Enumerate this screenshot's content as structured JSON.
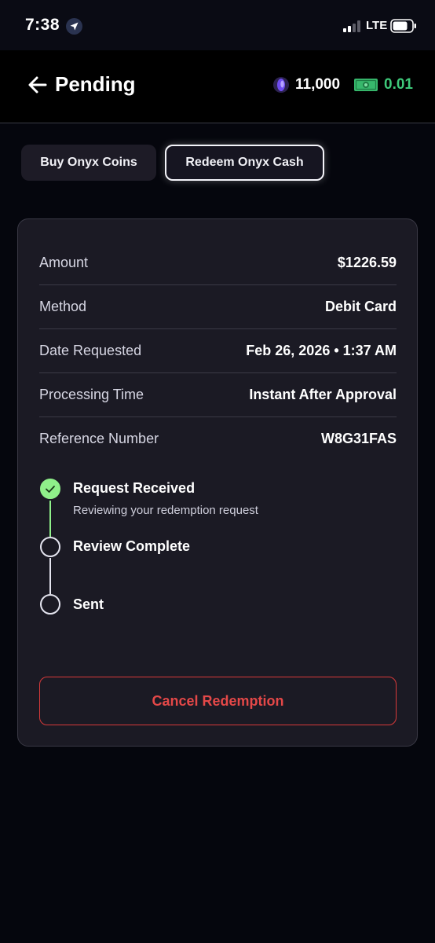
{
  "status_bar": {
    "time": "7:38",
    "network": "LTE"
  },
  "header": {
    "title": "Pending",
    "coin_balance": "11,000",
    "cash_balance": "0.01"
  },
  "tabs": [
    {
      "label": "Buy Onyx Coins",
      "active": false
    },
    {
      "label": "Redeem Onyx Cash",
      "active": true
    }
  ],
  "details": [
    {
      "label": "Amount",
      "value": "$1226.59"
    },
    {
      "label": "Method",
      "value": "Debit Card"
    },
    {
      "label": "Date Requested",
      "value": "Feb 26, 2026 • 1:37 AM"
    },
    {
      "label": "Processing Time",
      "value": "Instant After Approval"
    },
    {
      "label": "Reference Number",
      "value": "W8G31FAS"
    }
  ],
  "steps": [
    {
      "title": "Request Received",
      "subtitle": "Reviewing your redemption request",
      "done": true
    },
    {
      "title": "Review Complete",
      "done": false
    },
    {
      "title": "Sent",
      "done": false
    }
  ],
  "cancel_label": "Cancel Redemption",
  "colors": {
    "background": "#05060d",
    "card": "#1b1a24",
    "success": "#8ff08a",
    "cash_green": "#3ec97a",
    "danger": "#e44848"
  }
}
